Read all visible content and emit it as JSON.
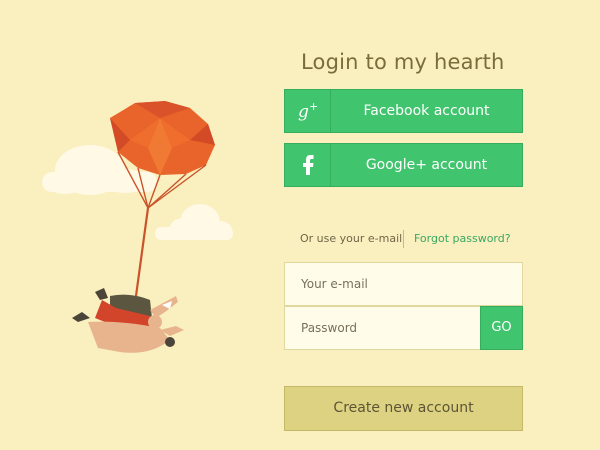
{
  "login": {
    "title": "Login to my hearth",
    "facebook_label": "Facebook account",
    "google_label": "Google+ account",
    "facebook_icon_glyph": "g+",
    "google_icon_glyph": "f",
    "alt_text": "Or use your e-mail",
    "forgot_link": "Forgot password?",
    "email_placeholder": "Your e-mail",
    "password_placeholder": "Password",
    "go_label": "GO",
    "create_label": "Create new account"
  },
  "colors": {
    "background": "#f9efbf",
    "accent_green": "#40c46d",
    "title_text": "#7b6d3a",
    "create_button": "#ddd282",
    "parachute": "#e8642a"
  },
  "icons": {
    "google_plus": "google-plus-icon",
    "facebook": "facebook-icon"
  }
}
